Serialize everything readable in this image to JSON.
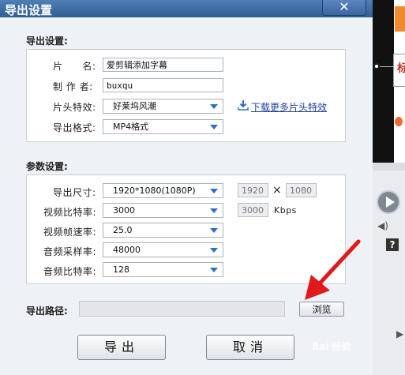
{
  "dialog": {
    "title": "导出设置",
    "close_label": "✕"
  },
  "export_settings": {
    "section_label": "导出设置:",
    "name_label": "片　　名:",
    "name_value": "爱剪辑添加字幕",
    "author_label": "制 作 者:",
    "author_value": "buxqu",
    "intro_label": "片头特效:",
    "intro_value": "好莱坞风潮",
    "download_link": "下载更多片头特效",
    "format_label": "导出格式:",
    "format_value": "MP4格式"
  },
  "params": {
    "section_label": "参数设置:",
    "size_label": "导出尺寸:",
    "size_value": "1920*1080(1080P)",
    "width_value": "1920",
    "times": "×",
    "height_value": "1080",
    "vbitrate_label": "视频比特率:",
    "vbitrate_value": "3000",
    "vbitrate_custom": "3000",
    "kbps": "Kbps",
    "fps_label": "视频帧速率:",
    "fps_value": "25.0",
    "asample_label": "音频采样率:",
    "asample_value": "48000",
    "abitrate_label": "音频比特率:",
    "abitrate_value": "128"
  },
  "path": {
    "label": "导出路径:",
    "value": "",
    "browse_label": "浏览"
  },
  "actions": {
    "export_label": "导出",
    "cancel_label": "取消"
  },
  "background_app": {
    "side_char": "标",
    "help_label": "?",
    "volume_icon": "◀)",
    "expand_icon": "▶"
  },
  "watermark": "Bai 经验",
  "colors": {
    "titlebar": "#3a67a3",
    "link": "#1c3f9e",
    "dropdown_arrow": "#2e6fc4",
    "annotation_arrow": "#e0191b"
  }
}
